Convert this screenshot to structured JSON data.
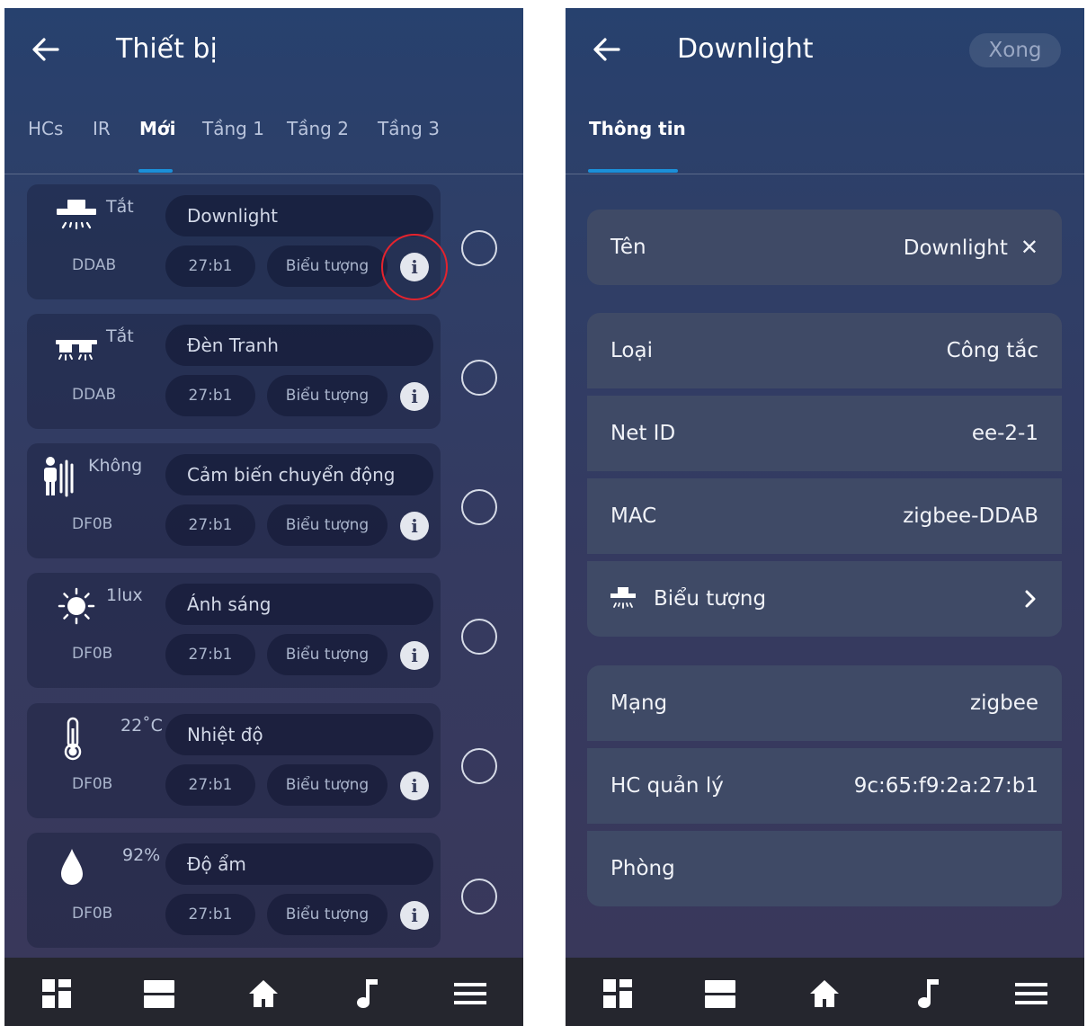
{
  "left_screen": {
    "title": "Thiết bị",
    "tabs": [
      {
        "label": "HCs"
      },
      {
        "label": "IR"
      },
      {
        "label": "Mới",
        "active": true
      },
      {
        "label": "Tầng 1"
      },
      {
        "label": "Tầng 2"
      },
      {
        "label": "Tầng 3"
      }
    ],
    "devices": [
      {
        "icon": "downlight-icon",
        "status": "Tắt",
        "code": "DDAB",
        "name": "Downlight",
        "hc": "27:b1",
        "icon_label": "Biểu tượng",
        "info_highlighted": true
      },
      {
        "icon": "picture-light-icon",
        "status": "Tắt",
        "code": "DDAB",
        "name": "Đèn Tranh",
        "hc": "27:b1",
        "icon_label": "Biểu tượng"
      },
      {
        "icon": "motion-sensor-icon",
        "status": "Không",
        "code": "DF0B",
        "name": "Cảm biến chuyển động",
        "hc": "27:b1",
        "icon_label": "Biểu tượng"
      },
      {
        "icon": "sun-icon",
        "status": "1lux",
        "code": "DF0B",
        "name": "Ánh sáng",
        "hc": "27:b1",
        "icon_label": "Biểu tượng"
      },
      {
        "icon": "thermometer-icon",
        "status": "22˚C",
        "code": "DF0B",
        "name": "Nhiệt độ",
        "hc": "27:b1",
        "icon_label": "Biểu tượng"
      },
      {
        "icon": "humidity-drop-icon",
        "status": "92%",
        "code": "DF0B",
        "name": "Độ ẩm",
        "hc": "27:b1",
        "icon_label": "Biểu tượng"
      }
    ],
    "info_glyph": "i"
  },
  "right_screen": {
    "title": "Downlight",
    "done_label": "Xong",
    "tab_label": "Thông tin",
    "clear_glyph": "✕",
    "rows": {
      "name": {
        "label": "Tên",
        "value": "Downlight"
      },
      "type": {
        "label": "Loại",
        "value": "Công tắc"
      },
      "net_id": {
        "label": "Net ID",
        "value": "ee-2-1"
      },
      "mac": {
        "label": "MAC",
        "value": "zigbee-DDAB"
      },
      "icon": {
        "label": "Biểu tượng",
        "icon": "downlight-icon"
      },
      "network": {
        "label": "Mạng",
        "value": "zigbee"
      },
      "hc": {
        "label": "HC quản lý",
        "value": "9c:65:f9:2a:27:b1"
      },
      "room": {
        "label": "Phòng",
        "value": ""
      }
    }
  },
  "bottom_nav": [
    "dashboard-icon",
    "rooms-icon",
    "home-icon",
    "music-icon",
    "menu-icon"
  ],
  "colors": {
    "tab_underline": "#1b8fd8",
    "highlight_ring": "#e5232d",
    "nav_background": "#25262e"
  }
}
